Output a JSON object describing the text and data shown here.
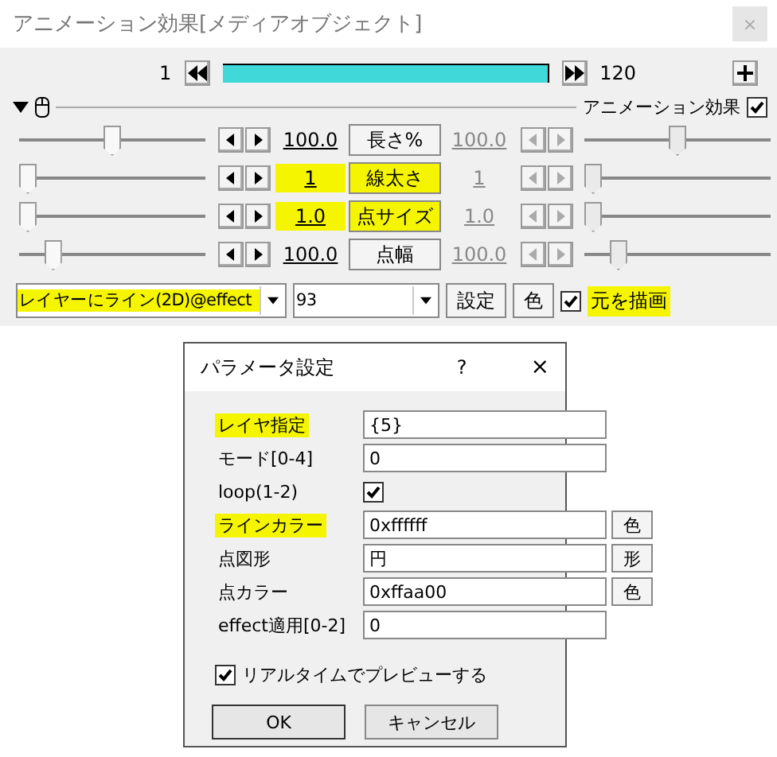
{
  "window": {
    "title": "アニメーション効果[メディアオブジェクト]",
    "close": "×"
  },
  "timeline": {
    "start": "1",
    "end": "120",
    "level": 1
  },
  "header": {
    "label": "アニメーション効果",
    "checked": true
  },
  "params": [
    {
      "left_slider": {
        "level": 0.5
      },
      "value": "100.0",
      "label": "長さ%",
      "right_value": "100.0",
      "right_slider": {
        "level": 0.5
      },
      "highlighted": false
    },
    {
      "left_slider": {
        "level": 0
      },
      "value": "1",
      "label": "線太さ",
      "right_value": "1",
      "right_slider": {
        "level": 0
      },
      "highlighted": true
    },
    {
      "left_slider": {
        "level": 0
      },
      "value": "1.0",
      "label": "点サイズ",
      "right_value": "1.0",
      "right_slider": {
        "level": 0
      },
      "highlighted": true
    },
    {
      "left_slider": {
        "level": 0.15
      },
      "value": "100.0",
      "label": "点幅",
      "right_value": "100.0",
      "right_slider": {
        "level": 0.15
      },
      "highlighted": false
    }
  ],
  "controls": {
    "effect": {
      "value": "レイヤーにライン(2D)@effect",
      "highlighted": true
    },
    "number": "93",
    "settings_button": "設定",
    "color_button": "色",
    "draw_original": {
      "label": "元を描画",
      "checked": true,
      "highlighted": true
    }
  },
  "dialog": {
    "title": "パラメータ設定",
    "help": "?",
    "close": "×",
    "rows": [
      {
        "kind": "field",
        "label": "レイヤ指定",
        "value": "{5}",
        "highlighted": true
      },
      {
        "kind": "field",
        "label": "モード[0-4]",
        "value": "0",
        "highlighted": false
      },
      {
        "kind": "checkbox",
        "label": "loop(1-2)",
        "checked": true,
        "highlighted": false
      },
      {
        "kind": "field",
        "label": "ラインカラー",
        "value": "0xffffff",
        "button": "色",
        "highlighted": true
      },
      {
        "kind": "field",
        "label": "点図形",
        "value": "円",
        "button": "形",
        "highlighted": false
      },
      {
        "kind": "field",
        "label": "点カラー",
        "value": "0xffaa00",
        "button": "色",
        "highlighted": false
      },
      {
        "kind": "field",
        "label": "effect適用[0-2]",
        "value": "0",
        "highlighted": false
      }
    ],
    "preview": {
      "label": "リアルタイムでプレビューする",
      "checked": true
    },
    "ok": "OK",
    "cancel": "キャンセル"
  }
}
